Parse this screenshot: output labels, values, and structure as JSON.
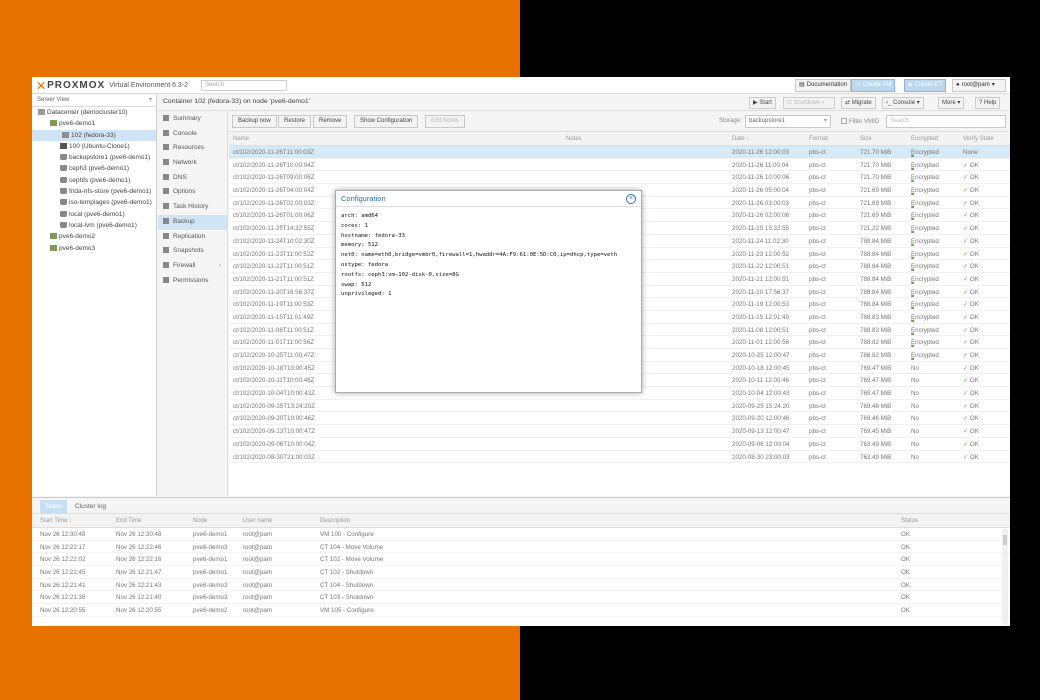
{
  "header": {
    "brand": "PROXMOX",
    "version": "Virtual Environment 6.3-2",
    "search_placeholder": "Search",
    "documentation": "Documentation",
    "create_vm": "Create VM",
    "create_ct": "Create CT",
    "user": "root@pam"
  },
  "tree": {
    "view": "Server View",
    "nodes": [
      {
        "label": "Datacenter (democluster10)",
        "indent": 6,
        "icon": "dc"
      },
      {
        "label": "pve6-demo1",
        "indent": 18,
        "icon": "srv"
      },
      {
        "label": "102 (fedora-33)",
        "indent": 30,
        "icon": "ct",
        "selected": true
      },
      {
        "label": "100 (Ubuntu-Clone1)",
        "indent": 28,
        "icon": "vm"
      },
      {
        "label": "backupstore1 (pve6-demo1)",
        "indent": 28,
        "icon": "db"
      },
      {
        "label": "ceph3 (pve6-demo1)",
        "indent": 28,
        "icon": "db"
      },
      {
        "label": "cephfs (pve6-demo1)",
        "indent": 28,
        "icon": "db"
      },
      {
        "label": "frida-nfs-store (pve6-demo1)",
        "indent": 28,
        "icon": "db"
      },
      {
        "label": "iso-templages (pve6-demo1)",
        "indent": 28,
        "icon": "db"
      },
      {
        "label": "local (pve6-demo1)",
        "indent": 28,
        "icon": "db"
      },
      {
        "label": "local-lvm (pve6-demo1)",
        "indent": 28,
        "icon": "db"
      },
      {
        "label": "pve6-demo2",
        "indent": 18,
        "icon": "srv"
      },
      {
        "label": "pve6-demo3",
        "indent": 18,
        "icon": "srv"
      }
    ]
  },
  "content": {
    "title": "Container 102 (fedora-33) on node 'pve6-demo1'",
    "actions": {
      "start": "Start",
      "shutdown": "Shutdown",
      "migrate": "Migrate",
      "console": "Console",
      "more": "More",
      "help": "Help"
    }
  },
  "sidenav": [
    {
      "label": "Summary"
    },
    {
      "label": "Console"
    },
    {
      "label": "Resources"
    },
    {
      "label": "Network"
    },
    {
      "label": "DNS"
    },
    {
      "label": "Options"
    },
    {
      "label": "Task History"
    },
    {
      "label": "Backup",
      "selected": true
    },
    {
      "label": "Replication"
    },
    {
      "label": "Snapshots"
    },
    {
      "label": "Firewall",
      "arrow": "›"
    },
    {
      "label": "Permissions"
    }
  ],
  "toolbar": {
    "backup_now": "Backup now",
    "restore": "Restore",
    "remove": "Remove",
    "show_config": "Show Configuration",
    "edit_notes": "Edit Notes",
    "storage_label": "Storage:",
    "storage_value": "backupstore1",
    "filter_vmid": "Filter VMID",
    "search_placeholder": "Search"
  },
  "grid": {
    "columns": {
      "name": "Name",
      "notes": "Notes",
      "date": "Date ↓",
      "format": "Format",
      "size": "Size",
      "encrypted": "Encrypted",
      "verify": "Verify State"
    },
    "rows": [
      {
        "name": "ct/102/2020-11-26T11:00:03Z",
        "date": "2020-11-26 12:00:03",
        "format": "pbs-ct",
        "size": "721.70 MiB",
        "enc": "Encrypted",
        "verify": "None",
        "encrypted": true,
        "verified": false,
        "selected": true
      },
      {
        "name": "ct/102/2020-11-26T10:00:04Z",
        "date": "2020-11-26 11:00:04",
        "format": "pbs-ct",
        "size": "721.70 MiB",
        "enc": "Encrypted",
        "verify": "OK",
        "encrypted": true,
        "verified": true
      },
      {
        "name": "ct/102/2020-11-26T09:00:06Z",
        "date": "2020-11-26 10:00:06",
        "format": "pbs-ct",
        "size": "721.70 MiB",
        "enc": "Encrypted",
        "verify": "OK",
        "encrypted": true,
        "verified": true
      },
      {
        "name": "ct/102/2020-11-26T04:00:04Z",
        "date": "2020-11-26 05:00:04",
        "format": "pbs-ct",
        "size": "721.69 MiB",
        "enc": "Encrypted",
        "verify": "OK",
        "encrypted": true,
        "verified": true
      },
      {
        "name": "ct/102/2020-11-26T02:00:03Z",
        "date": "2020-11-26 03:00:03",
        "format": "pbs-ct",
        "size": "721.69 MiB",
        "enc": "Encrypted",
        "verify": "OK",
        "encrypted": true,
        "verified": true
      },
      {
        "name": "ct/102/2020-11-26T01:00:06Z",
        "date": "2020-11-26 02:00:06",
        "format": "pbs-ct",
        "size": "721.69 MiB",
        "enc": "Encrypted",
        "verify": "OK",
        "encrypted": true,
        "verified": true
      },
      {
        "name": "ct/102/2020-11-25T14:32:55Z",
        "date": "2020-11-25 15:32:55",
        "format": "pbs-ct",
        "size": "721.22 MiB",
        "enc": "Encrypted",
        "verify": "OK",
        "encrypted": true,
        "verified": true
      },
      {
        "name": "ct/102/2020-11-24T10:02:30Z",
        "date": "2020-11-24 11:02:30",
        "format": "pbs-ct",
        "size": "788.84 MiB",
        "enc": "Encrypted",
        "verify": "OK",
        "encrypted": true,
        "verified": true
      },
      {
        "name": "ct/102/2020-11-23T11:00:52Z",
        "date": "2020-11-23 12:00:52",
        "format": "pbs-ct",
        "size": "788.84 MiB",
        "enc": "Encrypted",
        "verify": "OK",
        "encrypted": true,
        "verified": true
      },
      {
        "name": "ct/102/2020-11-22T11:00:51Z",
        "date": "2020-11-22 12:00:51",
        "format": "pbs-ct",
        "size": "788.84 MiB",
        "enc": "Encrypted",
        "verify": "OK",
        "encrypted": true,
        "verified": true
      },
      {
        "name": "ct/102/2020-11-21T11:00:51Z",
        "date": "2020-11-21 12:00:51",
        "format": "pbs-ct",
        "size": "788.84 MiB",
        "enc": "Encrypted",
        "verify": "OK",
        "encrypted": true,
        "verified": true
      },
      {
        "name": "ct/102/2020-11-20T16:56:37Z",
        "date": "2020-11-20 17:56:37",
        "format": "pbs-ct",
        "size": "788.84 MiB",
        "enc": "Encrypted",
        "verify": "OK",
        "encrypted": true,
        "verified": true
      },
      {
        "name": "ct/102/2020-11-19T11:00:53Z",
        "date": "2020-11-19 12:00:53",
        "format": "pbs-ct",
        "size": "788.84 MiB",
        "enc": "Encrypted",
        "verify": "OK",
        "encrypted": true,
        "verified": true
      },
      {
        "name": "ct/102/2020-11-15T11:01:49Z",
        "date": "2020-11-15 12:01:49",
        "format": "pbs-ct",
        "size": "788.83 MiB",
        "enc": "Encrypted",
        "verify": "OK",
        "encrypted": true,
        "verified": true
      },
      {
        "name": "ct/102/2020-11-08T11:00:51Z",
        "date": "2020-11-08 12:00:51",
        "format": "pbs-ct",
        "size": "788.83 MiB",
        "enc": "Encrypted",
        "verify": "OK",
        "encrypted": true,
        "verified": true
      },
      {
        "name": "ct/102/2020-11-01T11:00:56Z",
        "date": "2020-11-01 12:00:56",
        "format": "pbs-ct",
        "size": "788.82 MiB",
        "enc": "Encrypted",
        "verify": "OK",
        "encrypted": true,
        "verified": true
      },
      {
        "name": "ct/102/2020-10-25T11:00:47Z",
        "date": "2020-10-25 12:00:47",
        "format": "pbs-ct",
        "size": "788.82 MiB",
        "enc": "Encrypted",
        "verify": "OK",
        "encrypted": true,
        "verified": true
      },
      {
        "name": "ct/102/2020-10-18T10:00:45Z",
        "date": "2020-10-18 12:00:45",
        "format": "pbs-ct",
        "size": "769.47 MiB",
        "enc": "No",
        "verify": "OK",
        "encrypted": false,
        "verified": true
      },
      {
        "name": "ct/102/2020-10-11T10:00:46Z",
        "date": "2020-10-11 12:00:46",
        "format": "pbs-ct",
        "size": "769.47 MiB",
        "enc": "No",
        "verify": "OK",
        "encrypted": false,
        "verified": true
      },
      {
        "name": "ct/102/2020-10-04T10:00:43Z",
        "date": "2020-10-04 12:00:43",
        "format": "pbs-ct",
        "size": "769.47 MiB",
        "enc": "No",
        "verify": "OK",
        "encrypted": false,
        "verified": true
      },
      {
        "name": "ct/102/2020-09-25T13:24:20Z",
        "date": "2020-09-25 15:24:20",
        "format": "pbs-ct",
        "size": "769.46 MiB",
        "enc": "No",
        "verify": "OK",
        "encrypted": false,
        "verified": true
      },
      {
        "name": "ct/102/2020-09-20T10:00:46Z",
        "date": "2020-09-20 12:00:46",
        "format": "pbs-ct",
        "size": "769.46 MiB",
        "enc": "No",
        "verify": "OK",
        "encrypted": false,
        "verified": true
      },
      {
        "name": "ct/102/2020-09-13T10:00:47Z",
        "date": "2020-09-13 12:00:47",
        "format": "pbs-ct",
        "size": "769.45 MiB",
        "enc": "No",
        "verify": "OK",
        "encrypted": false,
        "verified": true
      },
      {
        "name": "ct/102/2020-09-06T10:00:04Z",
        "date": "2020-09-06 12:00:04",
        "format": "pbs-ct",
        "size": "763.49 MiB",
        "enc": "No",
        "verify": "OK",
        "encrypted": false,
        "verified": true
      },
      {
        "name": "ct/102/2020-08-30T21:00:03Z",
        "date": "2020-08-30 23:00:03",
        "format": "pbs-ct",
        "size": "763.49 MiB",
        "enc": "No",
        "verify": "OK",
        "encrypted": false,
        "verified": true
      }
    ]
  },
  "modal": {
    "title": "Configuration",
    "lines": [
      "arch: amd64",
      "cores: 1",
      "hostname: fedora-33",
      "memory: 512",
      "net0: name=eth0,bridge=vmbr0,firewall=1,hwaddr=4A:F9:61:0E:5D:C0,ip=dhcp,type=veth",
      "ostype: fedora",
      "rootfs: ceph3:vm-102-disk-0,size=8G",
      "swap: 512",
      "unprivileged: 1"
    ]
  },
  "bottom": {
    "tabs": [
      "Tasks",
      "Cluster log"
    ],
    "columns": {
      "start": "Start Time ↓",
      "end": "End Time",
      "node": "Node",
      "user": "User name",
      "desc": "Description",
      "status": "Status"
    },
    "rows": [
      {
        "start": "Nov 26 12:30:48",
        "end": "Nov 26 12:30:48",
        "node": "pve6-demo1",
        "user": "root@pam",
        "desc": "VM 100 - Configure",
        "status": "OK"
      },
      {
        "start": "Nov 26 12:22:17",
        "end": "Nov 26 12:22:46",
        "node": "pve6-demo3",
        "user": "root@pam",
        "desc": "CT 104 - Move Volume",
        "status": "OK"
      },
      {
        "start": "Nov 26 12:22:02",
        "end": "Nov 26 12:22:16",
        "node": "pve6-demo1",
        "user": "root@pam",
        "desc": "CT 102 - Move Volume",
        "status": "OK"
      },
      {
        "start": "Nov 26 12:21:45",
        "end": "Nov 26 12:21:47",
        "node": "pve6-demo1",
        "user": "root@pam",
        "desc": "CT 102 - Shutdown",
        "status": "OK"
      },
      {
        "start": "Nov 26 12:21:41",
        "end": "Nov 26 12:21:43",
        "node": "pve6-demo3",
        "user": "root@pam",
        "desc": "CT 104 - Shutdown",
        "status": "OK"
      },
      {
        "start": "Nov 26 12:21:38",
        "end": "Nov 26 12:21:40",
        "node": "pve6-demo3",
        "user": "root@pam",
        "desc": "CT 103 - Shutdown",
        "status": "OK"
      },
      {
        "start": "Nov 26 12:20:55",
        "end": "Nov 26 12:20:55",
        "node": "pve6-demo2",
        "user": "root@pam",
        "desc": "VM 105 - Configure",
        "status": "OK"
      }
    ]
  }
}
